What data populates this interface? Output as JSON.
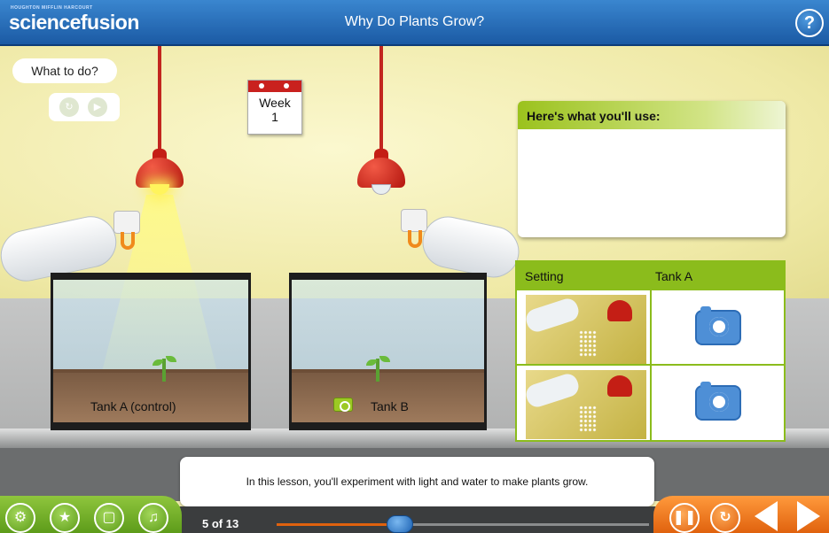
{
  "header": {
    "publisher": "HOUGHTON MIFFLIN HARCOURT",
    "logo": "sciencefusion",
    "title": "Why Do Plants Grow?",
    "help_icon": "?"
  },
  "instructions": {
    "what_to_do_label": "What to do?",
    "media_buttons": [
      "replay-icon",
      "play-icon"
    ]
  },
  "calendar": {
    "label": "Week",
    "value": "1"
  },
  "tanks": [
    {
      "label": "Tank A (control)",
      "lamp_on": true
    },
    {
      "label": "Tank B",
      "lamp_on": false
    }
  ],
  "materials": {
    "title": "Here's what you'll use:"
  },
  "results_table": {
    "headers": [
      "Setting",
      "Tank A"
    ],
    "rows": [
      {
        "setting_icon": "spray-and-lamp-image",
        "action_icon": "camera-icon"
      },
      {
        "setting_icon": "spray-and-lamp-image",
        "action_icon": "camera-icon"
      }
    ]
  },
  "caption": "In this lesson, you'll experiment with light and water to make plants grow.",
  "nav": {
    "page_indicator": "5 of 13",
    "progress_fraction": 0.33,
    "left_buttons": [
      "tools-icon",
      "activity-icon",
      "chat-icon",
      "audio-icon"
    ],
    "right_buttons": [
      "pause-icon",
      "restart-icon",
      "back-arrow-icon",
      "next-arrow-icon"
    ]
  },
  "colors": {
    "header_blue": "#1b5aa4",
    "accent_green": "#8bbc1c",
    "accent_orange": "#e0620e",
    "lamp_red": "#c41e15"
  }
}
